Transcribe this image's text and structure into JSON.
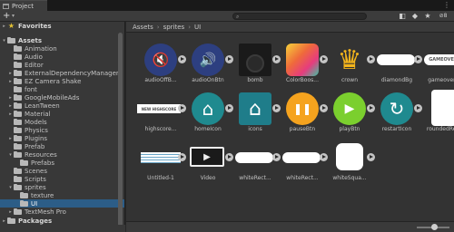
{
  "window": {
    "tab_title": "Project",
    "menu_glyph": "⋮"
  },
  "toolbar": {
    "add_glyph": "+",
    "add_caret": "▾",
    "search_placeholder": "",
    "search_icon": "🔍",
    "icons": [
      "tag-icon",
      "label-icon",
      "star-icon",
      "hidden-packages-icon"
    ],
    "hidden_count": "8"
  },
  "tree": [
    {
      "label": "Favorites",
      "indent": 0,
      "arrow": "▸",
      "kind": "star",
      "bold": true
    },
    {
      "label": "Assets",
      "indent": 0,
      "arrow": "▾",
      "kind": "folder",
      "bold": true
    },
    {
      "label": "Animation",
      "indent": 1,
      "arrow": "",
      "kind": "folder"
    },
    {
      "label": "Audio",
      "indent": 1,
      "arrow": "",
      "kind": "folder"
    },
    {
      "label": "Editor",
      "indent": 1,
      "arrow": "",
      "kind": "folder"
    },
    {
      "label": "ExternalDependencyManager",
      "indent": 1,
      "arrow": "▸",
      "kind": "folder"
    },
    {
      "label": "EZ Camera Shake",
      "indent": 1,
      "arrow": "▸",
      "kind": "folder"
    },
    {
      "label": "font",
      "indent": 1,
      "arrow": "",
      "kind": "folder"
    },
    {
      "label": "GoogleMobileAds",
      "indent": 1,
      "arrow": "▸",
      "kind": "folder"
    },
    {
      "label": "LeanTween",
      "indent": 1,
      "arrow": "▸",
      "kind": "folder"
    },
    {
      "label": "Material",
      "indent": 1,
      "arrow": "▸",
      "kind": "folder"
    },
    {
      "label": "Models",
      "indent": 1,
      "arrow": "",
      "kind": "folder"
    },
    {
      "label": "Physics",
      "indent": 1,
      "arrow": "",
      "kind": "folder"
    },
    {
      "label": "Plugins",
      "indent": 1,
      "arrow": "▸",
      "kind": "folder"
    },
    {
      "label": "Prefab",
      "indent": 1,
      "arrow": "",
      "kind": "folder"
    },
    {
      "label": "Resources",
      "indent": 1,
      "arrow": "▾",
      "kind": "folder"
    },
    {
      "label": "Prefabs",
      "indent": 2,
      "arrow": "",
      "kind": "folder"
    },
    {
      "label": "Scenes",
      "indent": 1,
      "arrow": "",
      "kind": "folder"
    },
    {
      "label": "Scripts",
      "indent": 1,
      "arrow": "",
      "kind": "folder"
    },
    {
      "label": "sprites",
      "indent": 1,
      "arrow": "▾",
      "kind": "folder"
    },
    {
      "label": "texture",
      "indent": 2,
      "arrow": "",
      "kind": "folder"
    },
    {
      "label": "UI",
      "indent": 2,
      "arrow": "",
      "kind": "folder",
      "selected": true
    },
    {
      "label": "TextMesh Pro",
      "indent": 1,
      "arrow": "▸",
      "kind": "folder"
    },
    {
      "label": "Packages",
      "indent": 0,
      "arrow": "▸",
      "kind": "folder",
      "bold": true
    }
  ],
  "breadcrumb": {
    "parts": [
      "Assets",
      "sprites",
      "UI"
    ],
    "separator": "›"
  },
  "assets": [
    {
      "label": "audioOffB...",
      "icon": "audio-off-icon",
      "style": "navy-circle",
      "glyph": "🔇"
    },
    {
      "label": "audioOnBtn",
      "icon": "audio-on-icon",
      "style": "navy-circle",
      "glyph": "🔊"
    },
    {
      "label": "bomb",
      "icon": "bomb-icon",
      "style": "bomb",
      "glyph": ""
    },
    {
      "label": "ColorBoos...",
      "icon": "color-boost-icon",
      "style": "gradient",
      "glyph": ""
    },
    {
      "label": "crown",
      "icon": "crown-icon",
      "style": "crown",
      "glyph": "♛"
    },
    {
      "label": "diamondBg",
      "icon": "diamond-bg-icon",
      "style": "white-pill",
      "glyph": ""
    },
    {
      "label": "gameover...",
      "icon": "game-over-icon",
      "style": "text-pill",
      "glyph": "GAMEOVER"
    },
    {
      "label": "highscore...",
      "icon": "highscore-icon",
      "style": "text-plain",
      "glyph": "NEW HIGHSCORE"
    },
    {
      "label": "homeIcon",
      "icon": "home-icon",
      "style": "teal-circle",
      "glyph": "⌂"
    },
    {
      "label": "icons",
      "icon": "icons-home-icon",
      "style": "teal-square",
      "glyph": "⌂"
    },
    {
      "label": "pauseBtn",
      "icon": "pause-icon",
      "style": "orange-circle",
      "glyph": "❚❚"
    },
    {
      "label": "playBtn",
      "icon": "play-icon",
      "style": "green-circle",
      "glyph": "▶"
    },
    {
      "label": "restartIcon",
      "icon": "restart-icon",
      "style": "teal-circle",
      "glyph": "↻"
    },
    {
      "label": "roundedRe...",
      "icon": "rounded-rect-icon",
      "style": "white-rounded",
      "glyph": ""
    },
    {
      "label": "Untitled-1",
      "icon": "untitled-icon",
      "style": "untitled",
      "glyph": ""
    },
    {
      "label": "Video",
      "icon": "video-icon",
      "style": "video",
      "glyph": "▶"
    },
    {
      "label": "whiteRect...",
      "icon": "white-rect-icon",
      "style": "white-pill",
      "glyph": ""
    },
    {
      "label": "whiteRect...",
      "icon": "white-rect-icon",
      "style": "white-pill",
      "glyph": ""
    },
    {
      "label": "whiteSqua...",
      "icon": "white-square-icon",
      "style": "white-square",
      "glyph": ""
    }
  ],
  "status": {
    "zoom_slider": 0.55
  }
}
